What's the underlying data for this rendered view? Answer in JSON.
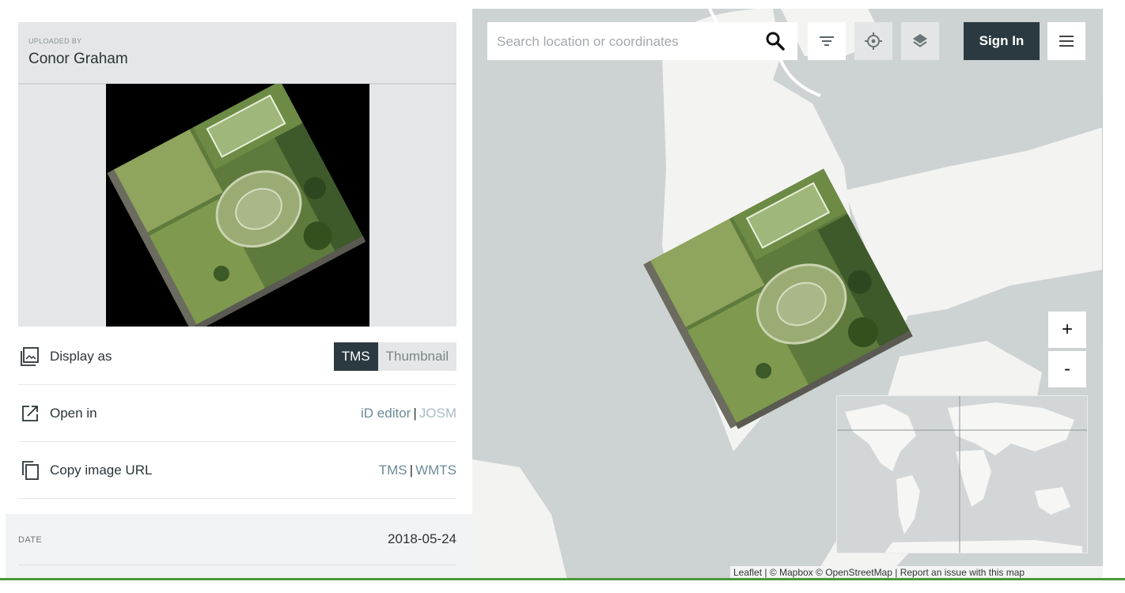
{
  "uploader": {
    "label": "UPLOADED BY",
    "name": "Conor Graham"
  },
  "rows": {
    "display_as": {
      "label": "Display as",
      "options": [
        "TMS",
        "Thumbnail"
      ],
      "selected": "TMS",
      "icon": "image-icon"
    },
    "open_in": {
      "label": "Open in",
      "links": [
        "iD editor",
        "JOSM"
      ],
      "separator": "|",
      "icon": "external-link-icon"
    },
    "copy_url": {
      "label": "Copy image URL",
      "links": [
        "TMS",
        "WMTS"
      ],
      "separator": "|",
      "icon": "copy-icon"
    }
  },
  "date": {
    "label": "DATE",
    "value": "2018-05-24"
  },
  "map": {
    "search_placeholder": "Search location or coordinates",
    "sign_in": "Sign In",
    "zoom_in": "+",
    "zoom_out": "-",
    "attribution": "Leaflet | © Mapbox © OpenStreetMap | Report an issue with this map"
  },
  "colors": {
    "dark": "#2b3a40",
    "link": "#6c8a94",
    "map_water": "#cdd2d3",
    "map_land": "#f3f3f2",
    "accent_line": "#4a9a3a"
  }
}
